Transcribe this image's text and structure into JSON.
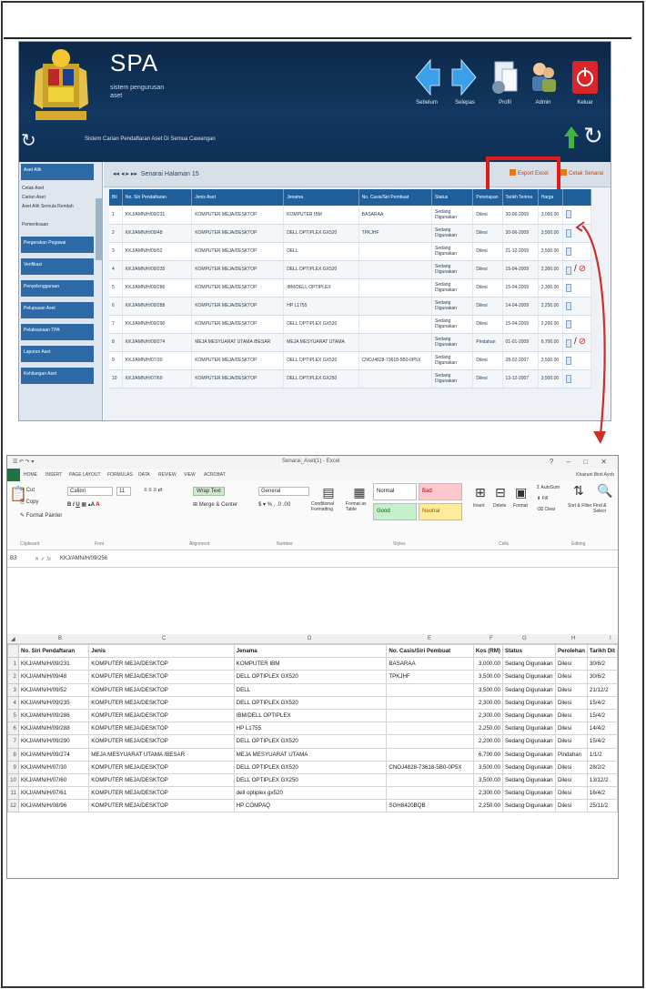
{
  "spa": {
    "title": "SPA",
    "subtitle_line1": "sistem pengurusan",
    "subtitle_line2": "aset",
    "tagline": "Sistem Carian Pendaftaran Aset Di Semua Cawangan",
    "nav": {
      "back": "Sebelum",
      "next": "Selepas",
      "profile": "Profil",
      "admin": "Admin",
      "logout": "Keluar"
    },
    "sidebar": {
      "items": [
        "Aset Alih",
        "Pergerakan Pegawai",
        "Verifikasi",
        "Penyelenggaraan",
        "Pelupusan Aset",
        "Pelaksanaan TPA",
        "Laporan Aset",
        "Kehilangan Aset"
      ],
      "subitems": [
        "Cetak Aset",
        "Carian Aset",
        "Aset Alih Semula Rendah",
        "Pemeriksaan"
      ]
    },
    "toolbar": {
      "pager": "Senarai Halaman 15",
      "export_excel": "Export Excel",
      "export_print": "Cetak Senarai"
    },
    "table": {
      "headers": [
        "Bil",
        "No. Siri Pendaftaran",
        "Jenis Aset",
        "Jenama",
        "No. Casis/Siri Pembuat",
        "Status",
        "Penetapan",
        "Tarikh Terima",
        "Harga",
        ""
      ],
      "rows": [
        [
          "1",
          "KKJ/AMN/H/09/231",
          "KOMPUTER MEJA/DESKTOP",
          "KOMPUTER IBM",
          "BASARAA",
          "Sedang Digunakan",
          "Dilesi",
          "30-06-2009",
          "3,000.00"
        ],
        [
          "2",
          "KKJ/AMN/H/09/48",
          "KOMPUTER MEJA/DESKTOP",
          "DELL OPTIPLEX GX520",
          "TPKJHF",
          "Sedang Digunakan",
          "Dilesi",
          "30-06-2009",
          "3,500.00"
        ],
        [
          "3",
          "KKJ/AMN/H/09/52",
          "KOMPUTER MEJA/DESKTOP",
          "DELL",
          "",
          "Sedang Digunakan",
          "Dilesi",
          "21-12-2009",
          "3,500.00"
        ],
        [
          "4",
          "KKJ/AMN/H/09/235",
          "KOMPUTER MEJA/DESKTOP",
          "DELL OPTIPLEX GX520",
          "",
          "Sedang Digunakan",
          "Dilesi",
          "15-04-2009",
          "2,300.00"
        ],
        [
          "5",
          "KKJ/AMN/H/09/286",
          "KOMPUTER MEJA/DESKTOP",
          "IBM/DELL OPTIPLEX",
          "",
          "Sedang Digunakan",
          "Dilesi",
          "15-04-2009",
          "2,300.00"
        ],
        [
          "6",
          "KKJ/AMN/H/09/288",
          "KOMPUTER MEJA/DESKTOP",
          "HP L1755",
          "",
          "Sedang Digunakan",
          "Dilesi",
          "14-04-2009",
          "2,250.00"
        ],
        [
          "7",
          "KKJ/AMN/H/09/290",
          "KOMPUTER MEJA/DESKTOP",
          "DELL OPTIPLEX GX520",
          "",
          "Sedang Digunakan",
          "Dilesi",
          "15-04-2009",
          "2,200.00"
        ],
        [
          "8",
          "KKJ/AMN/H/09/274",
          "MEJA MESYUARAT UTAMA /BESAR",
          "MEJA MESYUARAT UTAMA",
          "",
          "Sedang Digunakan",
          "Pindahan",
          "01-01-2009",
          "6,700.00"
        ],
        [
          "9",
          "KKJ/AMN/H/07/30",
          "KOMPUTER MEJA/DESKTOP",
          "DELL OPTIPLEX GX520",
          "CNOJ4828-73618-5B0-0P5X",
          "Sedang Digunakan",
          "Dilesi",
          "28-02-2007",
          "3,500.00"
        ],
        [
          "10",
          "KKJ/AMN/H/07/60",
          "KOMPUTER MEJA/DESKTOP",
          "DELL OPTIPLEX GX250",
          "",
          "Sedang Digunakan",
          "Dilesi",
          "13-12-2007",
          "3,500.00"
        ]
      ]
    }
  },
  "excel": {
    "window_title": "Senarai_Aset(1) - Excel",
    "user": "Khairani Binti Ayob",
    "tabs": [
      "FILE",
      "HOME",
      "INSERT",
      "PAGE LAYOUT",
      "FORMULAS",
      "DATA",
      "REVIEW",
      "VIEW",
      "ACROBAT"
    ],
    "ribbon": {
      "cut": "Cut",
      "copy": "Copy",
      "format_painter": "Format Painter",
      "font_name": "Calibri",
      "font_size": "11",
      "wrap_text": "Wrap Text",
      "merge_center": "Merge & Center",
      "number_format": "General",
      "conditional_formatting": "Conditional Formatting",
      "format_as_table": "Format as Table",
      "style_normal": "Normal",
      "style_bad": "Bad",
      "style_good": "Good",
      "style_neutral": "Neutral",
      "insert": "Insert",
      "delete": "Delete",
      "format": "Format",
      "autosum": "AutoSum",
      "fill": "Fill",
      "clear": "Clear",
      "sort_filter": "Sort & Filter",
      "find_select": "Find & Select",
      "groups": [
        "Clipboard",
        "Font",
        "Alignment",
        "Number",
        "Styles",
        "Cells",
        "Editing"
      ]
    },
    "formula_bar": {
      "cell_ref": "B3",
      "fx": "fx",
      "value": "KKJ/AMN/H/09/256"
    },
    "columns": [
      "A",
      "B",
      "C",
      "D",
      "E",
      "F",
      "G",
      "H",
      "I"
    ],
    "headers": [
      "No. Siri Pendaftaran",
      "Jenis",
      "Jenama",
      "No. Casis/Siri Pembuat",
      "Kos (RM)",
      "Status",
      "Perolehan",
      "Tarikh Dit"
    ],
    "rows": [
      [
        "1",
        "KKJ/AMN/H/09/231",
        "KOMPUTER MEJA/DESKTOP",
        "KOMPUTER IBM",
        "BASARAA",
        "3,000.00",
        "Sedang Digunakan",
        "Dilesi",
        "30/6/2"
      ],
      [
        "2",
        "KKJ/AMN/H/09/48",
        "KOMPUTER MEJA/DESKTOP",
        "DELL OPTIPLEX GX520",
        "TPKJHF",
        "3,500.00",
        "Sedang Digunakan",
        "Dilesi",
        "30/6/2"
      ],
      [
        "3",
        "KKJ/AMN/H/09/52",
        "KOMPUTER MEJA/DESKTOP",
        "DELL",
        "",
        "3,500.00",
        "Sedang Digunakan",
        "Dilesi",
        "21/12/2"
      ],
      [
        "4",
        "KKJ/AMN/H/09/235",
        "KOMPUTER MEJA/DESKTOP",
        "DELL OPTIPLEX GX520",
        "",
        "2,300.00",
        "Sedang Digunakan",
        "Dilesi",
        "15/4/2"
      ],
      [
        "5",
        "KKJ/AMN/H/09/286",
        "KOMPUTER MEJA/DESKTOP",
        "IBM/DELL OPTIPLEX",
        "",
        "2,300.00",
        "Sedang Digunakan",
        "Dilesi",
        "15/4/2"
      ],
      [
        "6",
        "KKJ/AMN/H/09/288",
        "KOMPUTER MEJA/DESKTOP",
        "HP L1755",
        "",
        "2,250.00",
        "Sedang Digunakan",
        "Dilesi",
        "14/4/2"
      ],
      [
        "7",
        "KKJ/AMN/H/09/290",
        "KOMPUTER MEJA/DESKTOP",
        "DELL OPTIPLEX GX520",
        "",
        "2,200.00",
        "Sedang Digunakan",
        "Dilesi",
        "15/4/2"
      ],
      [
        "8",
        "KKJ/AMN/H/09/274",
        "MEJA MESYUARAT UTAMA /BESAR",
        "MEJA MESYUARAT UTAMA",
        "",
        "6,700.00",
        "Sedang Digunakan",
        "Pindahan",
        "1/1/2"
      ],
      [
        "9",
        "KKJ/AMN/H/07/30",
        "KOMPUTER MEJA/DESKTOP",
        "DELL OPTIPLEX GX520",
        "CNOJ4828-73618-5B0-0P5X",
        "3,500.00",
        "Sedang Digunakan",
        "Dilesi",
        "28/2/2"
      ],
      [
        "10",
        "KKJ/AMN/H/07/60",
        "KOMPUTER MEJA/DESKTOP",
        "DELL OPTIPLEX GX250",
        "",
        "3,500.00",
        "Sedang Digunakan",
        "Dilesi",
        "13/12/2"
      ],
      [
        "11",
        "KKJ/AMN/H/07/61",
        "KOMPUTER MEJA/DESKTOP",
        "dell optiplex gx520",
        "",
        "2,300.00",
        "Sedang Digunakan",
        "Dilesi",
        "16/4/2"
      ],
      [
        "12",
        "KKJ/AMN/H/08/96",
        "KOMPUTER MEJA/DESKTOP",
        "HP COMPAQ",
        "SGH8420BQB",
        "2,250.00",
        "Sedang Digunakan",
        "Dilesi",
        "25/11/2"
      ]
    ]
  },
  "colors": {
    "spa_header": "#123760",
    "spa_table_header": "#1f5f9c",
    "highlight_box": "#e01b1b",
    "arrow": "#c9302c",
    "excel_green": "#217346"
  }
}
